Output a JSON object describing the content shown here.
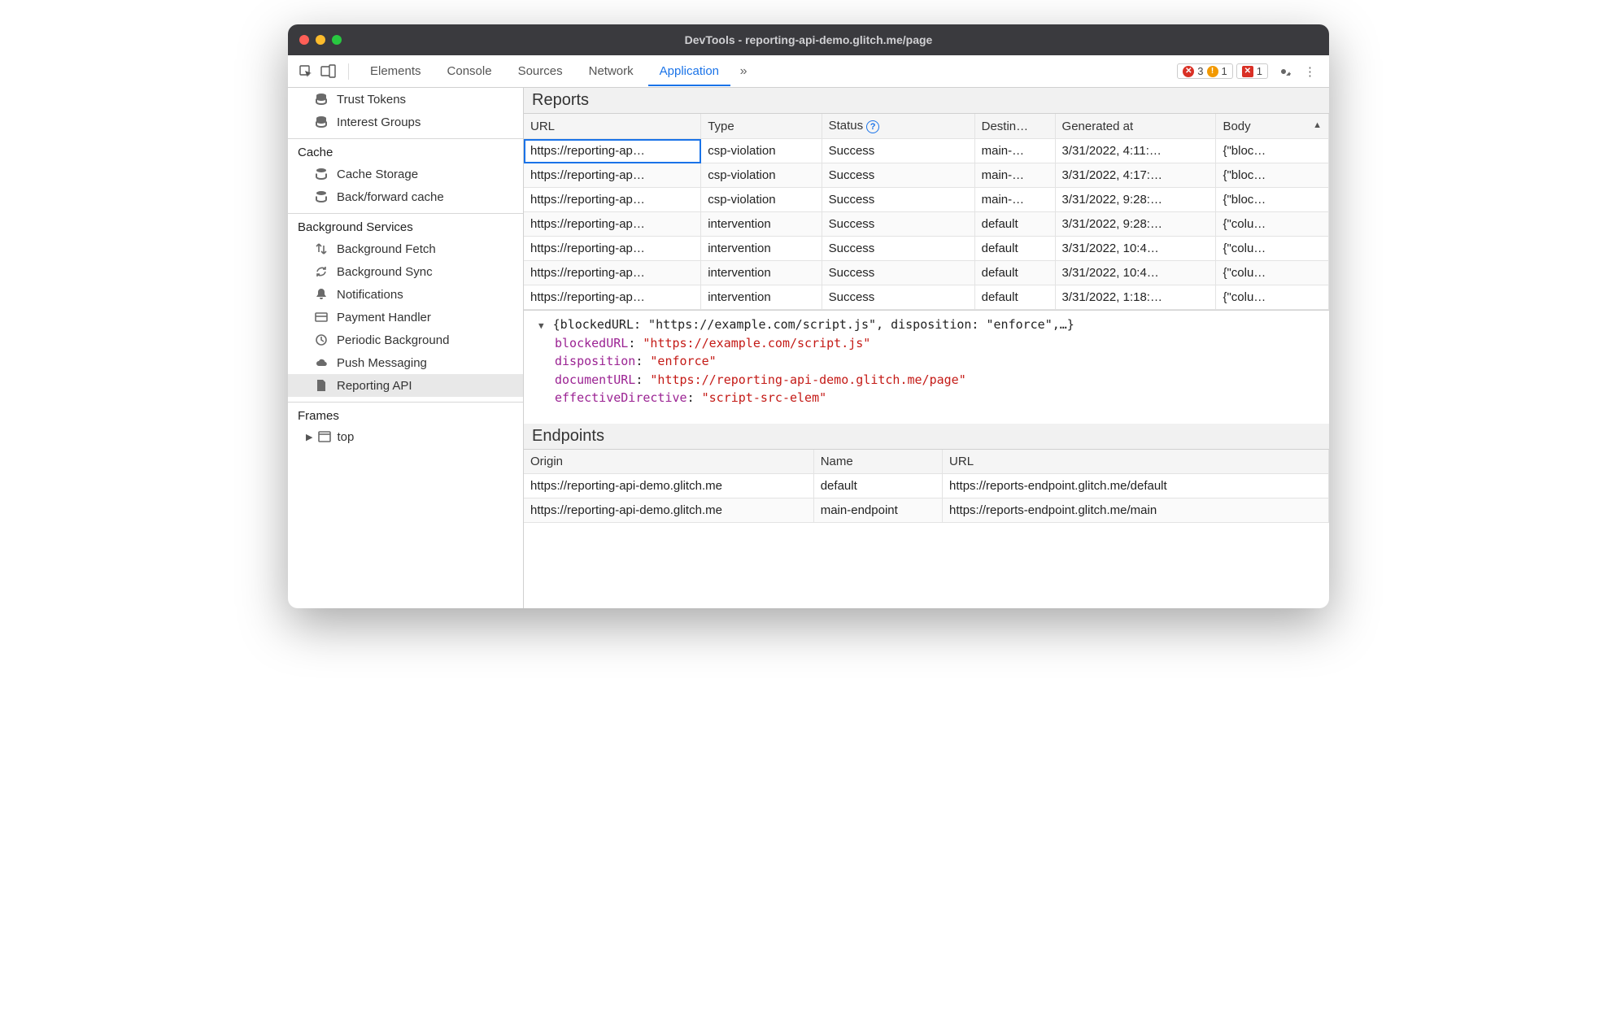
{
  "window": {
    "title": "DevTools - reporting-api-demo.glitch.me/page"
  },
  "toolbar": {
    "tabs": [
      "Elements",
      "Console",
      "Sources",
      "Network",
      "Application"
    ],
    "active_tab": "Application",
    "error_count": "3",
    "warn_count": "1",
    "issue_count": "1"
  },
  "sidebar": {
    "top_items": [
      "Trust Tokens",
      "Interest Groups"
    ],
    "groups": [
      {
        "title": "Cache",
        "items": [
          "Cache Storage",
          "Back/forward cache"
        ]
      },
      {
        "title": "Background Services",
        "items": [
          "Background Fetch",
          "Background Sync",
          "Notifications",
          "Payment Handler",
          "Periodic Background",
          "Push Messaging",
          "Reporting API"
        ]
      },
      {
        "title": "Frames",
        "items": [
          "top"
        ]
      }
    ],
    "selected": "Reporting API"
  },
  "reports": {
    "title": "Reports",
    "columns": [
      "URL",
      "Type",
      "Status",
      "Destin…",
      "Generated at",
      "Body"
    ],
    "rows": [
      {
        "url": "https://reporting-ap…",
        "type": "csp-violation",
        "status": "Success",
        "dest": "main-…",
        "gen": "3/31/2022, 4:11:…",
        "body": "{\"bloc…"
      },
      {
        "url": "https://reporting-ap…",
        "type": "csp-violation",
        "status": "Success",
        "dest": "main-…",
        "gen": "3/31/2022, 4:17:…",
        "body": "{\"bloc…"
      },
      {
        "url": "https://reporting-ap…",
        "type": "csp-violation",
        "status": "Success",
        "dest": "main-…",
        "gen": "3/31/2022, 9:28:…",
        "body": "{\"bloc…"
      },
      {
        "url": "https://reporting-ap…",
        "type": "intervention",
        "status": "Success",
        "dest": "default",
        "gen": "3/31/2022, 9:28:…",
        "body": "{\"colu…"
      },
      {
        "url": "https://reporting-ap…",
        "type": "intervention",
        "status": "Success",
        "dest": "default",
        "gen": "3/31/2022, 10:4…",
        "body": "{\"colu…"
      },
      {
        "url": "https://reporting-ap…",
        "type": "intervention",
        "status": "Success",
        "dest": "default",
        "gen": "3/31/2022, 10:4…",
        "body": "{\"colu…"
      },
      {
        "url": "https://reporting-ap…",
        "type": "intervention",
        "status": "Success",
        "dest": "default",
        "gen": "3/31/2022, 1:18:…",
        "body": "{\"colu…"
      }
    ]
  },
  "detail": {
    "summary": "{blockedURL: \"https://example.com/script.js\", disposition: \"enforce\",…}",
    "props": [
      {
        "k": "blockedURL",
        "v": "\"https://example.com/script.js\""
      },
      {
        "k": "disposition",
        "v": "\"enforce\""
      },
      {
        "k": "documentURL",
        "v": "\"https://reporting-api-demo.glitch.me/page\""
      },
      {
        "k": "effectiveDirective",
        "v": "\"script-src-elem\""
      }
    ]
  },
  "endpoints": {
    "title": "Endpoints",
    "columns": [
      "Origin",
      "Name",
      "URL"
    ],
    "rows": [
      {
        "origin": "https://reporting-api-demo.glitch.me",
        "name": "default",
        "url": "https://reports-endpoint.glitch.me/default"
      },
      {
        "origin": "https://reporting-api-demo.glitch.me",
        "name": "main-endpoint",
        "url": "https://reports-endpoint.glitch.me/main"
      }
    ]
  }
}
